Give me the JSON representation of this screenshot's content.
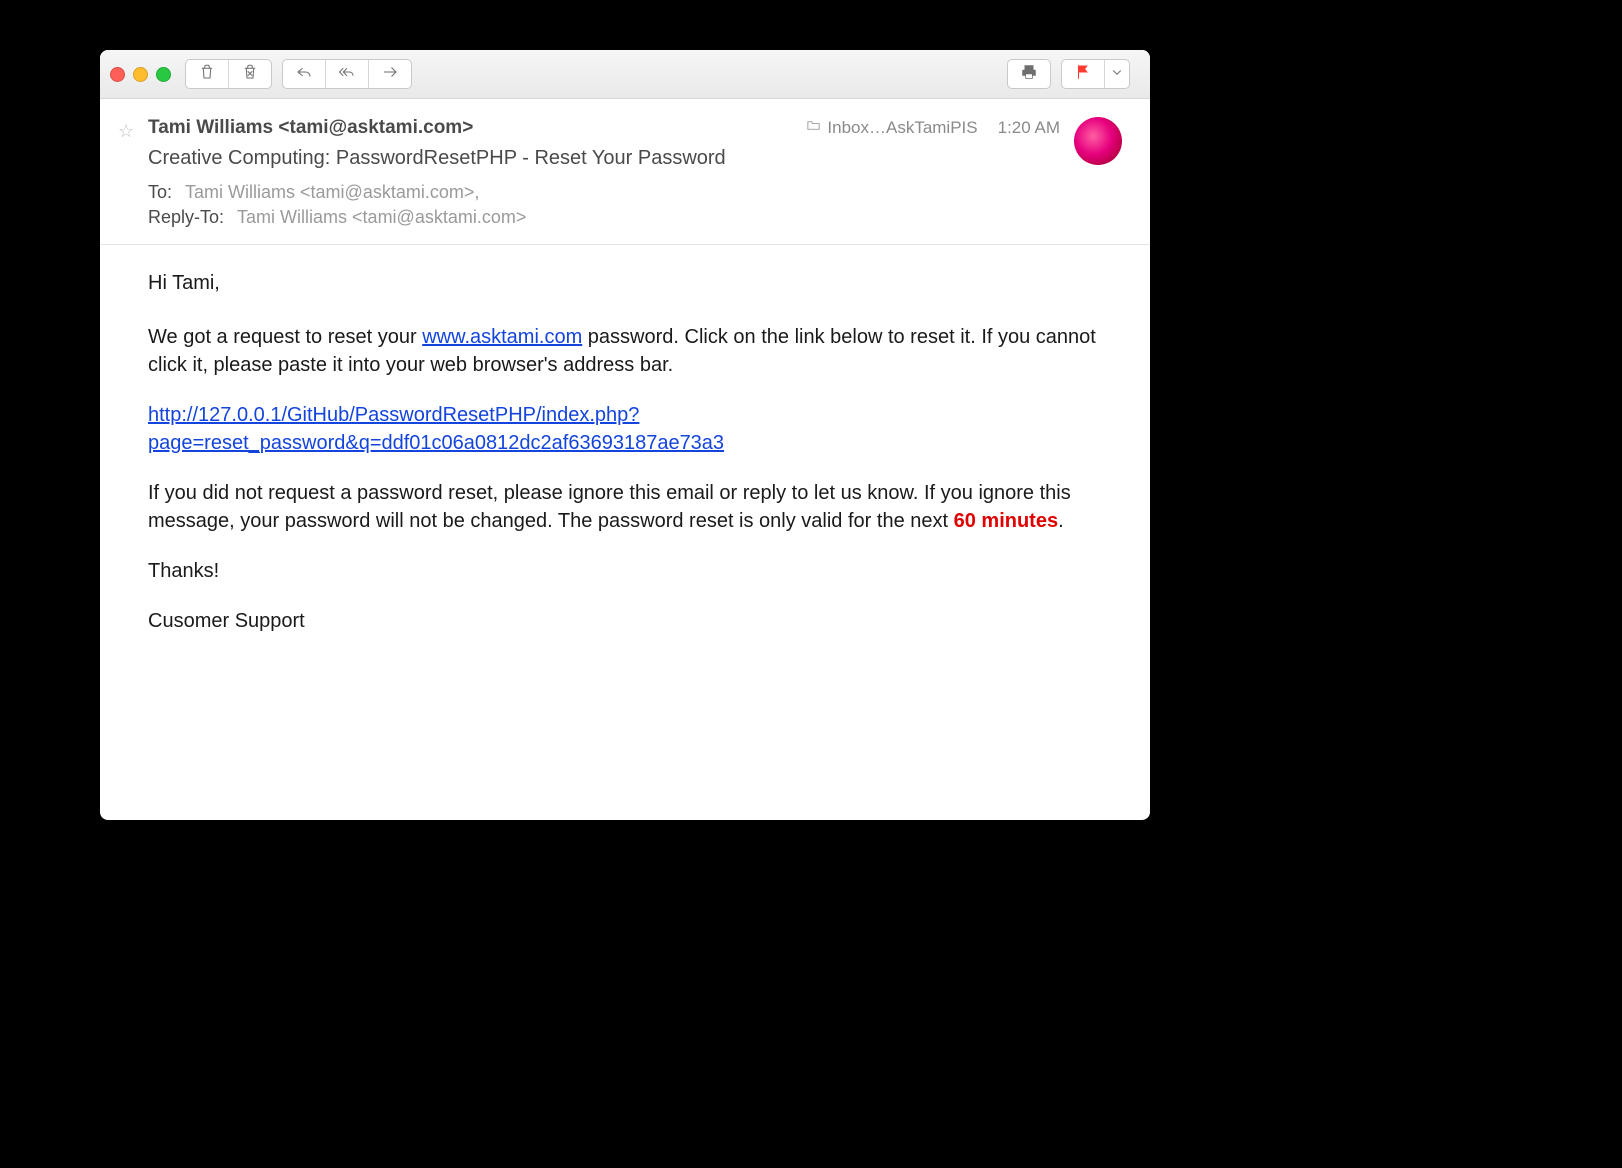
{
  "toolbar": {
    "icons": {
      "trash": "trash-icon",
      "junk": "junk-icon",
      "reply": "reply-icon",
      "reply_all": "reply-all-icon",
      "forward": "forward-icon",
      "print": "print-icon",
      "flag": "flag-icon",
      "dropdown": "chevron-down-icon"
    }
  },
  "header": {
    "from": "Tami Williams <tami@asktami.com>",
    "folder": "Inbox…AskTamiPIS",
    "time": "1:20 AM",
    "subject": "Creative Computing: PasswordResetPHP - Reset Your Password",
    "to_label": "To:",
    "to_value": "Tami Williams <tami@asktami.com>,",
    "reply_to_label": "Reply-To:",
    "reply_to_value": "Tami Williams <tami@asktami.com>"
  },
  "body": {
    "greeting": "Hi Tami,",
    "p1_text_before": "We got a request to reset your ",
    "p1_link_text": "www.asktami.com",
    "p1_text_after": " password. Click on the link below to reset it. If you cannot click it, please paste it into your web browser's address bar.",
    "reset_url": "http://127.0.0.1/GitHub/PasswordResetPHP/index.php?page=reset_password&q=ddf01c06a0812dc2af63693187ae73a3",
    "p2_text_before": "If you did not request a password reset, please ignore this email or reply to let us know. If you ignore this message, your password will not be changed. The password reset is only valid for the next ",
    "p2_emph": "60 minutes",
    "p2_text_after": ".",
    "thanks": "Thanks!",
    "signature": "Cusomer Support"
  }
}
